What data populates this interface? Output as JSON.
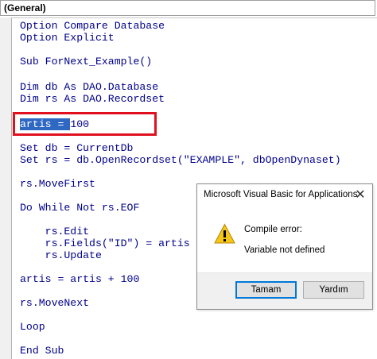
{
  "toolbar": {
    "object_combo_value": "(General)"
  },
  "code": {
    "lines": [
      "Option Compare Database",
      "Option Explicit",
      "",
      "Sub ForNext_Example()",
      "",
      "Dim db As DAO.Database",
      "Dim rs As DAO.Recordset",
      "",
      "",
      "",
      "Set db = CurrentDb",
      "Set rs = db.OpenRecordset(\"EXAMPLE\", dbOpenDynaset)",
      "",
      "rs.MoveFirst",
      "",
      "Do While Not rs.EOF",
      "",
      "    rs.Edit",
      "    rs.Fields(\"ID\") = artis",
      "    rs.Update",
      "",
      "artis = artis + 100",
      "",
      "rs.MoveNext",
      "",
      "Loop",
      "",
      "End Sub"
    ],
    "highlighted_line": {
      "selected_text": "artis = ",
      "rest_text": "100"
    }
  },
  "colors": {
    "highlight_box": "#e0101e",
    "selection": "#2f68c3",
    "code_text": "#00008b"
  },
  "dialog": {
    "title": "Microsoft Visual Basic for Applications",
    "close_glyph": "✕",
    "icon": "warning-icon",
    "message_line1": "Compile error:",
    "message_line2": "Variable not defined",
    "ok_button": "Tamam",
    "help_button": "Yardım"
  }
}
